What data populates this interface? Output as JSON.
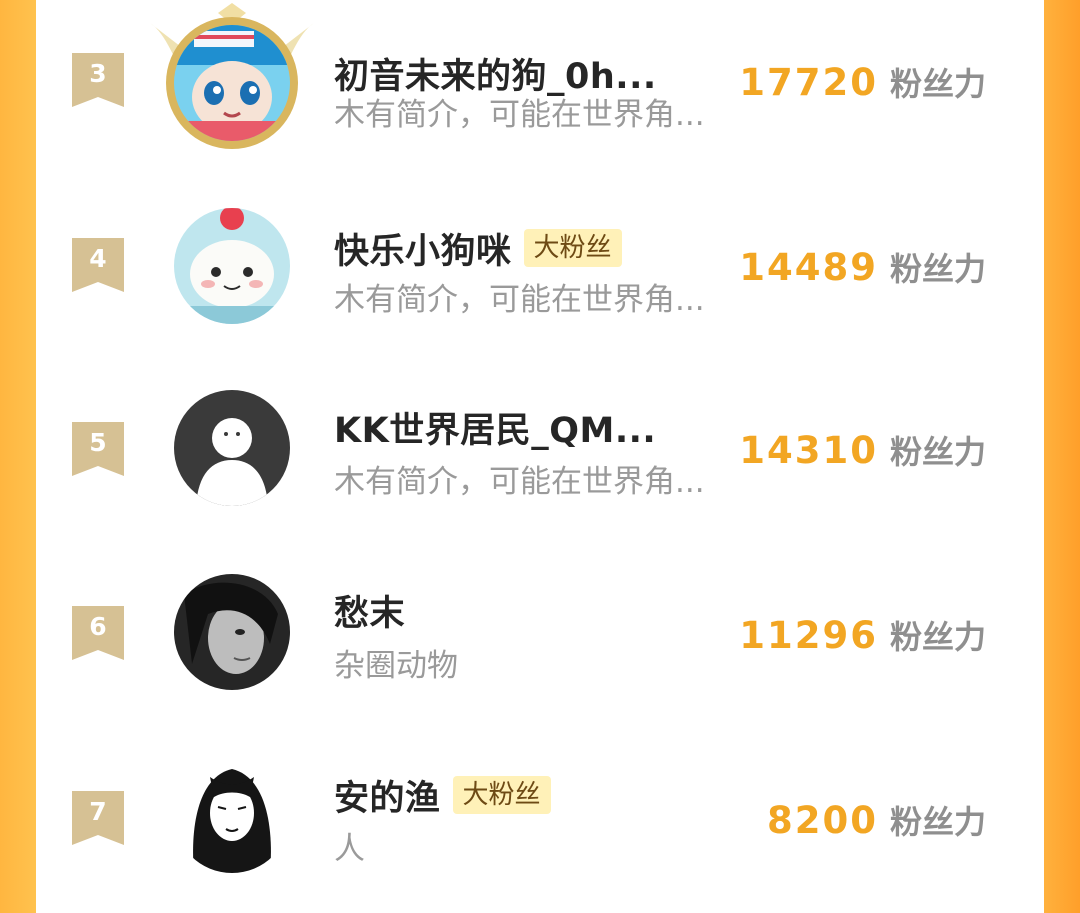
{
  "colors": {
    "accent": "#f2a623",
    "frame": "#ffb13d",
    "tag_bg": "#fff1b8",
    "rank_badge": "#d6c194"
  },
  "fans": [
    {
      "rank": "3",
      "name": "初音未来的狗_0h...",
      "tag": "",
      "bio": "木有简介，可能在世界角...",
      "score": "17720",
      "unit": "粉丝力"
    },
    {
      "rank": "4",
      "name": "快乐小狗咪",
      "tag": "大粉丝",
      "bio": "木有简介，可能在世界角...",
      "score": "14489",
      "unit": "粉丝力"
    },
    {
      "rank": "5",
      "name": "KK世界居民_QM...",
      "tag": "",
      "bio": "木有简介，可能在世界角...",
      "score": "14310",
      "unit": "粉丝力"
    },
    {
      "rank": "6",
      "name": "愁末",
      "tag": "",
      "bio": "杂圈动物",
      "score": "11296",
      "unit": "粉丝力"
    },
    {
      "rank": "7",
      "name": "安的渔",
      "tag": "大粉丝",
      "bio": "人",
      "score": "8200",
      "unit": "粉丝力"
    }
  ]
}
